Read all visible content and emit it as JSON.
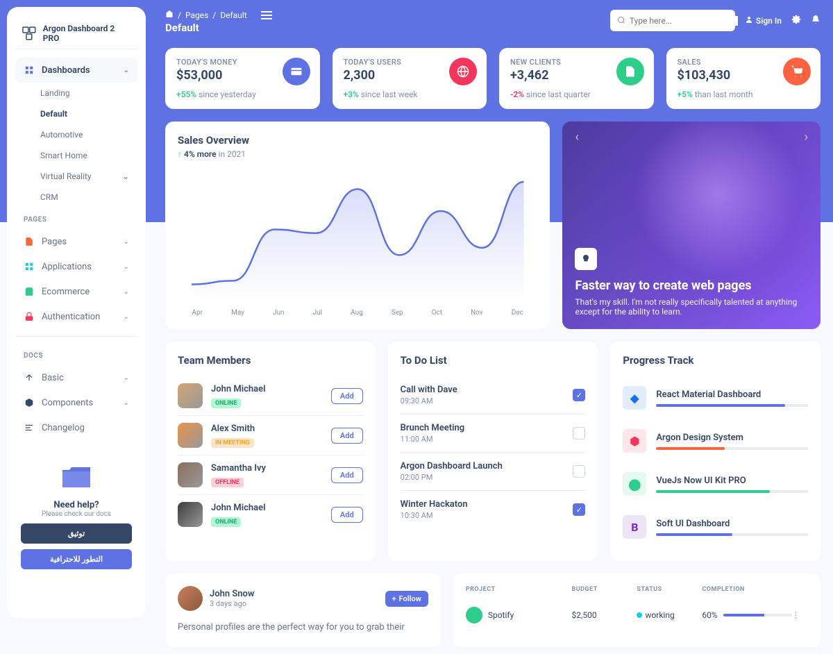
{
  "brand": "Argon Dashboard 2 PRO",
  "breadcrumb": {
    "sep1": "/",
    "pages": "Pages",
    "sep2": "/",
    "current": "Default"
  },
  "page_title": "Default",
  "search": {
    "placeholder": "Type here..."
  },
  "signin": "Sign In",
  "sidebar": {
    "dashboards": "Dashboards",
    "sub": {
      "landing": "Landing",
      "default": "Default",
      "automotive": "Automotive",
      "smarthome": "Smart Home",
      "vr": "Virtual Reality",
      "crm": "CRM"
    },
    "pages_label": "PAGES",
    "pages": "Pages",
    "applications": "Applications",
    "ecommerce": "Ecommerce",
    "authentication": "Authentication",
    "docs_label": "DOCS",
    "basic": "Basic",
    "components": "Components",
    "changelog": "Changelog"
  },
  "help": {
    "title": "Need help?",
    "sub": "Please check our docs",
    "btn1": "توثيق",
    "btn2": "التطور للاحترافية"
  },
  "stats": [
    {
      "label": "TODAY'S MONEY",
      "value": "$53,000",
      "change": "+55%",
      "change_pos": true,
      "suffix": "since yesterday",
      "icon_bg": "#5e72e4"
    },
    {
      "label": "TODAY'S USERS",
      "value": "2,300",
      "change": "+3%",
      "change_pos": true,
      "suffix": "since last week",
      "icon_bg": "#f5365c"
    },
    {
      "label": "NEW CLIENTS",
      "value": "+3,462",
      "change": "-2%",
      "change_pos": false,
      "suffix": "since last quarter",
      "icon_bg": "#2dce89"
    },
    {
      "label": "SALES",
      "value": "$103,430",
      "change": "+5%",
      "change_pos": true,
      "suffix": "than last month",
      "icon_bg": "#fb6340"
    }
  ],
  "chart": {
    "title": "Sales Overview",
    "pct": "4% more",
    "suffix": "in 2021"
  },
  "chart_data": {
    "type": "line",
    "categories": [
      "Apr",
      "May",
      "Jun",
      "Jul",
      "Aug",
      "Sep",
      "Oct",
      "Nov",
      "Dec"
    ],
    "values": [
      20,
      25,
      95,
      90,
      150,
      60,
      120,
      70,
      160
    ],
    "ylim": [
      0,
      170
    ]
  },
  "promo": {
    "title": "Faster way to create web pages",
    "text": "That's my skill. I'm not really specifically talented at anything except for the ability to learn."
  },
  "team": {
    "title": "Team Members",
    "members": [
      {
        "name": "John Michael",
        "status": "ONLINE",
        "status_class": "online"
      },
      {
        "name": "Alex Smith",
        "status": "IN MEETING",
        "status_class": "meeting"
      },
      {
        "name": "Samantha Ivy",
        "status": "OFFLINE",
        "status_class": "offline"
      },
      {
        "name": "John Michael",
        "status": "ONLINE",
        "status_class": "online"
      }
    ],
    "add": "Add"
  },
  "todo": {
    "title": "To Do List",
    "items": [
      {
        "title": "Call with Dave",
        "time": "09:30 AM",
        "done": true
      },
      {
        "title": "Brunch Meeting",
        "time": "11:00 AM",
        "done": false
      },
      {
        "title": "Argon Dashboard Launch",
        "time": "02:00 PM",
        "done": false
      },
      {
        "title": "Winter Hackaton",
        "time": "10:30 AM",
        "done": true
      }
    ]
  },
  "track": {
    "title": "Progress Track",
    "items": [
      {
        "title": "React Material Dashboard",
        "pct": 85,
        "color": "#5e72e4",
        "icon_bg": "#1171ef"
      },
      {
        "title": "Argon Design System",
        "pct": 45,
        "color": "#fb6340",
        "icon_bg": "#f5365c"
      },
      {
        "title": "VueJs Now UI Kit PRO",
        "pct": 75,
        "color": "#2dce89",
        "icon_bg": "#2dce89"
      },
      {
        "title": "Soft UI Dashboard",
        "pct": 50,
        "color": "#5e72e4",
        "icon_bg": "#7928ca"
      }
    ]
  },
  "post": {
    "name": "John Snow",
    "time": "3 days ago",
    "follow": "Follow",
    "body": "Personal profiles are the perfect way for you to grab their"
  },
  "table": {
    "headers": {
      "project": "PROJECT",
      "budget": "BUDGET",
      "status": "STATUS",
      "completion": "COMPLETION"
    },
    "rows": [
      {
        "name": "Spotify",
        "budget": "$2,500",
        "status": "working",
        "status_color": "#11cdef",
        "completion": "60%",
        "pct": 60,
        "icon_bg": "#2dce89"
      }
    ]
  }
}
